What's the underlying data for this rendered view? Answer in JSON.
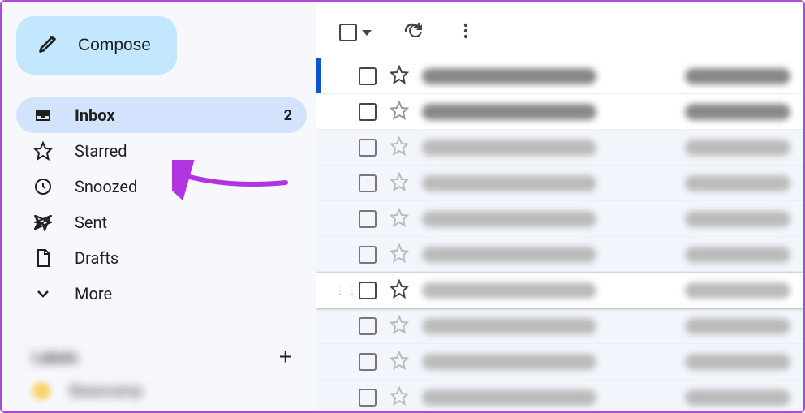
{
  "compose": {
    "label": "Compose"
  },
  "nav": {
    "inbox": {
      "label": "Inbox",
      "count": "2"
    },
    "starred": {
      "label": "Starred"
    },
    "snoozed": {
      "label": "Snoozed"
    },
    "sent": {
      "label": "Sent"
    },
    "drafts": {
      "label": "Drafts"
    },
    "more": {
      "label": "More"
    }
  },
  "labels": {
    "header": "Labels",
    "items": [
      {
        "name": "Basecamp",
        "color": "#fad165"
      }
    ]
  },
  "messages": [
    {
      "unread": true,
      "selected": true
    },
    {
      "unread": true
    },
    {
      "unread": false
    },
    {
      "unread": false
    },
    {
      "unread": false
    },
    {
      "unread": false
    },
    {
      "unread": false,
      "hovered": true
    },
    {
      "unread": false
    },
    {
      "unread": false
    },
    {
      "unread": false
    }
  ]
}
